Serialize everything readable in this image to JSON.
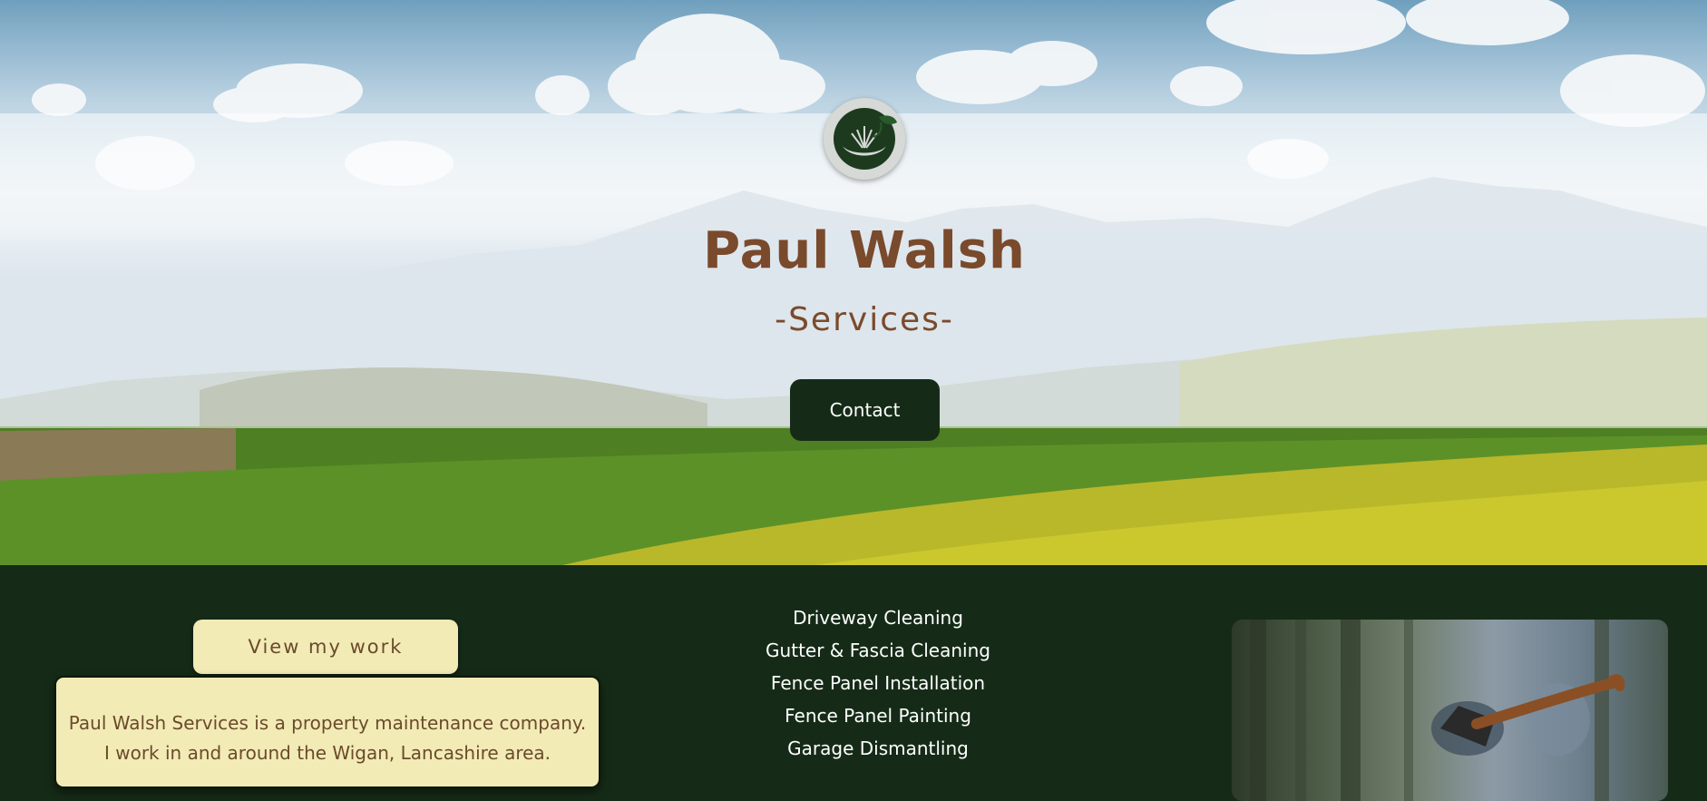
{
  "hero": {
    "title": "Paul Walsh",
    "subtitle": "-Services-",
    "contact_label": "Contact",
    "logo_icon": "grass-leaf-logo-icon"
  },
  "about": {
    "view_work_label": "View my work",
    "line1": "Paul Walsh Services is a property maintenance company.",
    "line2": "I work in and around the Wigan, Lancashire area."
  },
  "services": {
    "items": [
      "Driveway Cleaning",
      "Gutter & Fascia Cleaning",
      "Fence Panel Installation",
      "Fence Panel Painting",
      "Garage Dismantling"
    ]
  },
  "photo": {
    "subject_icon": "axe-in-stump-photo"
  },
  "colors": {
    "dark_green": "#152b17",
    "brown_text": "#7a4a2c",
    "cream": "#f2ebb6",
    "white": "#ffffff"
  }
}
